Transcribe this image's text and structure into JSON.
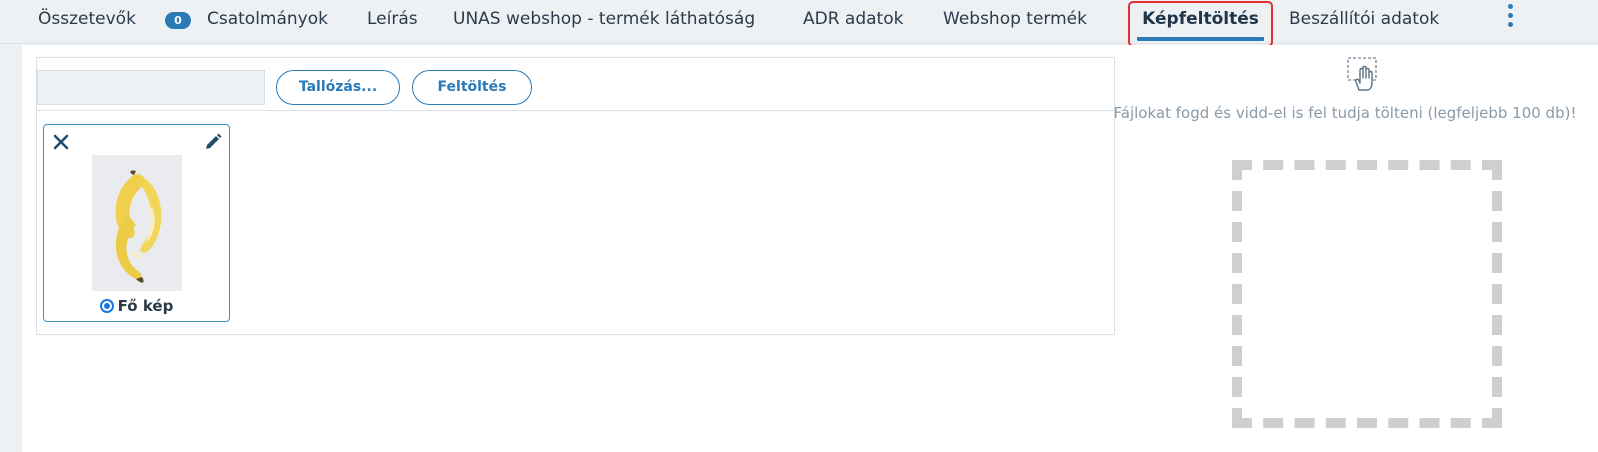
{
  "tabs": {
    "osszetevok": "Összetevők",
    "badge": "0",
    "csatolmanyok": "Csatolmányok",
    "leiras": "Leírás",
    "unas": "UNAS webshop - termék láthatóság",
    "adr": "ADR adatok",
    "webshop": "Webshop termék",
    "kepfeltoltes": "Képfeltöltés",
    "beszallitoi": "Beszállítói adatok"
  },
  "upload": {
    "browse_label": "Tallózás...",
    "upload_label": "Feltöltés",
    "file_value": ""
  },
  "image_card": {
    "main_label": "Fő kép",
    "is_main": true
  },
  "dropzone": {
    "hint": "Fájlokat fogd és vidd-el is fel tudja tölteni (legfeljebb 100 db)!"
  },
  "colors": {
    "accent": "#2a7ab8",
    "highlight": "#e3302f",
    "dropzone_border": "#cfcfcf"
  }
}
